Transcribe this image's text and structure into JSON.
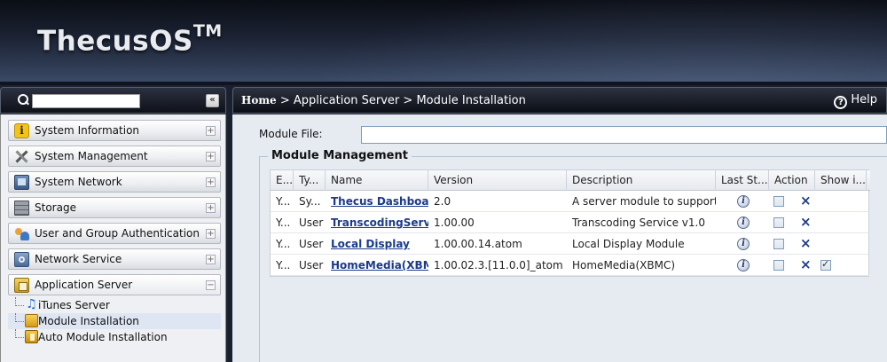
{
  "app": {
    "logo_text": "ThecusOS",
    "logo_tm": "TM"
  },
  "sidebar": {
    "search": {
      "value": "",
      "placeholder": ""
    },
    "collapse_label": "«",
    "items": [
      {
        "label": "System Information",
        "icon": "info-icon",
        "toggle": "+"
      },
      {
        "label": "System Management",
        "icon": "tools-icon",
        "toggle": "+"
      },
      {
        "label": "System Network",
        "icon": "network-icon",
        "toggle": "+"
      },
      {
        "label": "Storage",
        "icon": "storage-icon",
        "toggle": "+"
      },
      {
        "label": "User and Group Authentication",
        "icon": "users-icon",
        "toggle": "+"
      },
      {
        "label": "Network Service",
        "icon": "network-service-icon",
        "toggle": "+"
      },
      {
        "label": "Application Server",
        "icon": "application-server-icon",
        "toggle": "−"
      }
    ],
    "sub_items": [
      {
        "label": "iTunes Server",
        "icon": "music-note-icon"
      },
      {
        "label": "Module Installation",
        "icon": "module-icon"
      },
      {
        "label": "Auto Module Installation",
        "icon": "auto-module-icon"
      }
    ]
  },
  "header": {
    "breadcrumb_home": "Home",
    "breadcrumb_sep1": ">",
    "breadcrumb_mid": "Application Server",
    "breadcrumb_sep2": ">",
    "breadcrumb_current": "Module Installation",
    "help_label": "Help",
    "help_icon": "?"
  },
  "form": {
    "module_file_label": "Module File:",
    "module_file_value": ""
  },
  "module_management": {
    "legend": "Module Management",
    "columns": [
      "E...",
      "Ty...",
      "Name",
      "Version",
      "Description",
      "Last St...",
      "Action",
      "Show i..."
    ],
    "rows": [
      {
        "enabled": "Y...",
        "type": "Sy...",
        "name": "Thecus Dashboard",
        "version": "2.0",
        "description": "A server module to support",
        "show": false
      },
      {
        "enabled": "Y...",
        "type": "User",
        "name": "TranscodingService",
        "version": "1.00.00",
        "description": "Transcoding Service v1.0",
        "show": false
      },
      {
        "enabled": "Y...",
        "type": "User",
        "name": "Local Display",
        "version": "1.00.00.14.atom",
        "description": "Local Display Module",
        "show": false
      },
      {
        "enabled": "Y...",
        "type": "User",
        "name": "HomeMedia(XBMC)",
        "version": "1.00.02.3.[11.0.0]_atom",
        "description": "HomeMedia(XBMC)",
        "show": true
      }
    ],
    "info_glyph": "i",
    "delete_glyph": "×"
  }
}
